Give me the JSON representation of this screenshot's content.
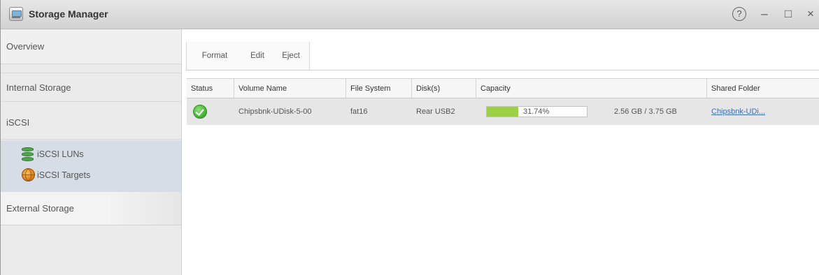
{
  "window": {
    "title": "Storage Manager",
    "help_glyph": "?",
    "minimize_glyph": "–",
    "maximize_glyph": "□",
    "close_glyph": "×"
  },
  "sidebar": {
    "overview": "Overview",
    "internal_storage": "Internal Storage",
    "iscsi": "iSCSI",
    "iscsi_luns": "iSCSI LUNs",
    "iscsi_targets": "iSCSI Targets",
    "external_storage": "External Storage"
  },
  "toolbar": {
    "format": "Format",
    "edit": "Edit",
    "eject": "Eject"
  },
  "table": {
    "headers": {
      "status": "Status",
      "volume_name": "Volume Name",
      "file_system": "File System",
      "disks": "Disk(s)",
      "capacity": "Capacity",
      "shared_folder": "Shared Folder"
    },
    "rows": [
      {
        "status": "ok",
        "volume_name": "Chipsbnk-UDisk-5-00",
        "file_system": "fat16",
        "disks": "Rear USB2",
        "capacity_percent": 31.74,
        "capacity_percent_text": "31.74%",
        "capacity_text": "2.56 GB / 3.75 GB",
        "shared_folder": "Chipsbnk-UDi..."
      }
    ]
  },
  "colors": {
    "capacity_fill": "#9ed046",
    "status_ok": "#3fae2e",
    "link": "#3c6fb5",
    "selected_group_bg": "#d7dde6"
  },
  "icons": {
    "app": "storage-manager-icon",
    "luns": "database-icon",
    "targets": "globe-icon",
    "status": "check-circle-icon"
  }
}
